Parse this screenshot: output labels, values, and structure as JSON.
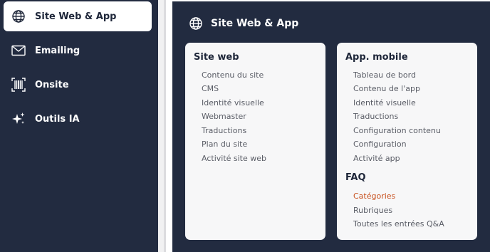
{
  "sidebar": {
    "items": [
      {
        "label": "Site Web & App",
        "icon": "globe-icon",
        "active": true
      },
      {
        "label": "Emailing",
        "icon": "envelope-icon",
        "active": false
      },
      {
        "label": "Onsite",
        "icon": "barcode-frame-icon",
        "active": false
      },
      {
        "label": "Outils IA",
        "icon": "sparkles-icon",
        "active": false
      }
    ]
  },
  "panel": {
    "title": "Site Web & App",
    "icon": "globe-icon",
    "site_web": {
      "title": "Site web",
      "links": [
        "Contenu du site",
        "CMS",
        "Identité visuelle",
        "Webmaster",
        "Traductions",
        "Plan du site",
        "Activité site web"
      ]
    },
    "app_mobile": {
      "title": "App. mobile",
      "links": [
        "Tableau de bord",
        "Contenu de l'app",
        "Identité visuelle",
        "Traductions",
        "Configuration contenu",
        "Configuration",
        "Activité app"
      ]
    },
    "faq": {
      "title": "FAQ",
      "links": [
        "Catégories",
        "Rubriques",
        "Toutes les entrées Q&A"
      ],
      "highlighted": "Catégories"
    }
  },
  "colors": {
    "dark_bg": "#222b40",
    "card_bg": "#f7f7f8",
    "accent": "#c8501e",
    "link_text": "#5a5d66"
  }
}
